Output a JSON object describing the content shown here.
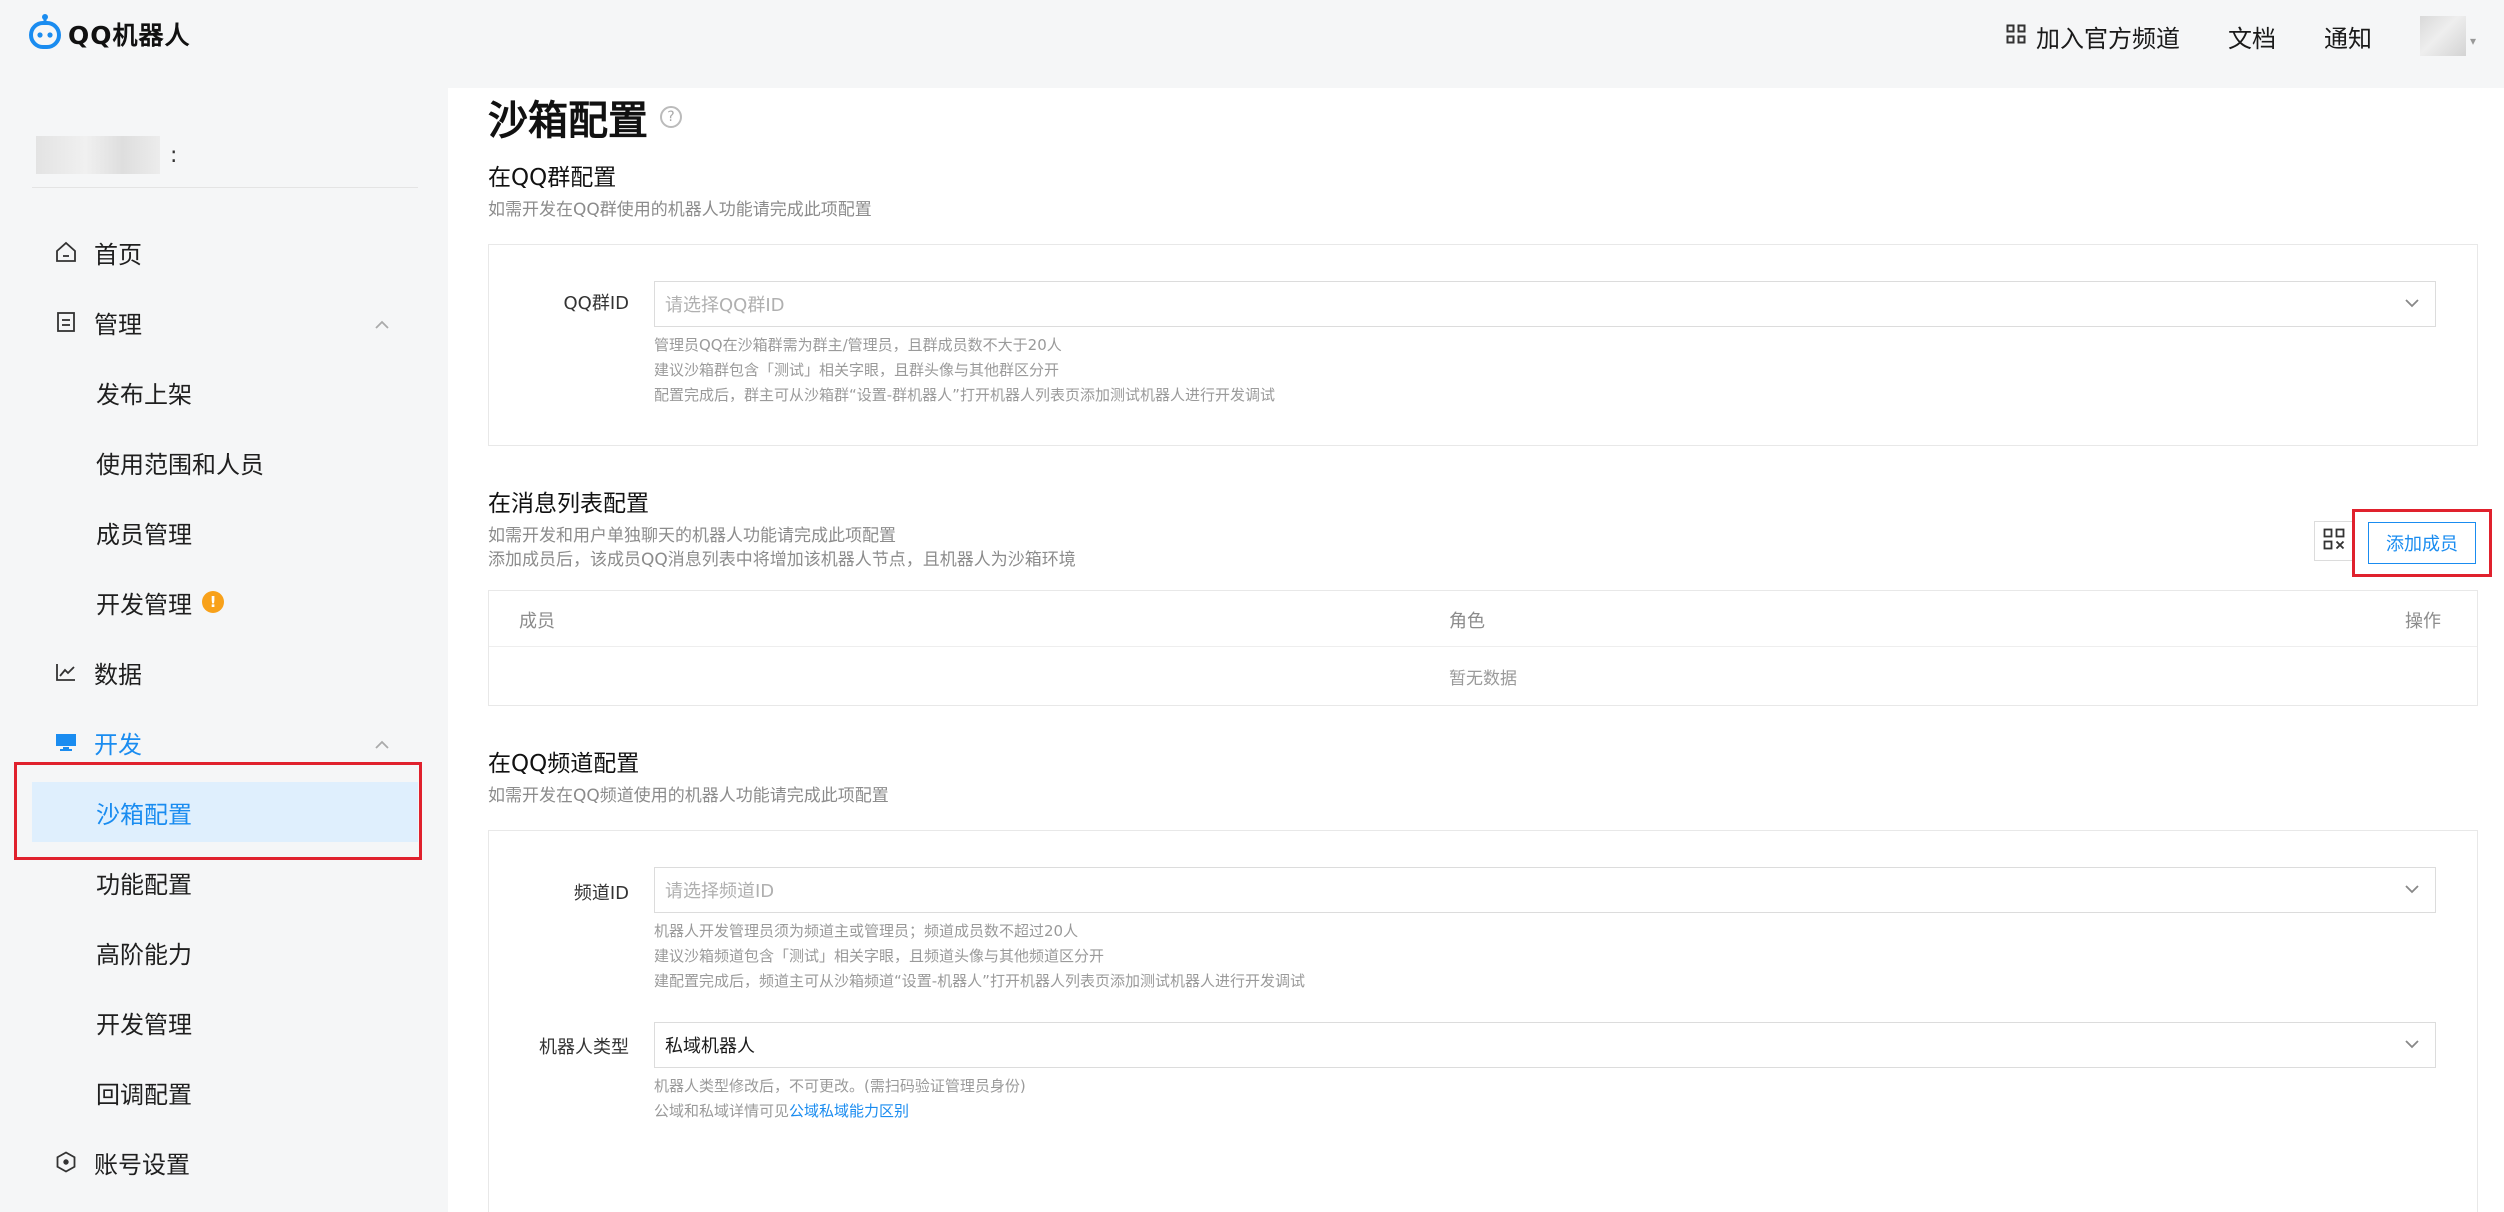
{
  "app": {
    "logo_text": "QQ机器人"
  },
  "topnav": {
    "join_channel": "加入官方频道",
    "docs": "文档",
    "notify": "通知"
  },
  "sidebar": {
    "app_name_suffix": ":",
    "items": [
      {
        "label": "首页"
      },
      {
        "label": "管理"
      },
      {
        "label": "发布上架"
      },
      {
        "label": "使用范围和人员"
      },
      {
        "label": "成员管理"
      },
      {
        "label": "开发管理",
        "badge": "!"
      },
      {
        "label": "数据"
      },
      {
        "label": "开发"
      },
      {
        "label": "沙箱配置"
      },
      {
        "label": "功能配置"
      },
      {
        "label": "高阶能力"
      },
      {
        "label": "开发管理"
      },
      {
        "label": "回调配置"
      },
      {
        "label": "账号设置"
      }
    ]
  },
  "main": {
    "title": "沙箱配置",
    "help": "?",
    "group": {
      "title": "在QQ群配置",
      "desc": "如需开发在QQ群使用的机器人功能请完成此项配置",
      "field_label": "QQ群ID",
      "placeholder": "请选择QQ群ID",
      "hints": [
        "管理员QQ在沙箱群需为群主/管理员，且群成员数不大于20人",
        "建议沙箱群包含「测试」相关字眼，且群头像与其他群区分开",
        "配置完成后，群主可从沙箱群“设置-群机器人”打开机器人列表页添加测试机器人进行开发调试"
      ]
    },
    "msglist": {
      "title": "在消息列表配置",
      "desc1": "如需开发和用户单独聊天的机器人功能请完成此项配置",
      "desc2": "添加成员后，该成员QQ消息列表中将增加该机器人节点，且机器人为沙箱环境",
      "add_button": "添加成员",
      "columns": [
        "成员",
        "角色",
        "操作"
      ],
      "empty": "暂无数据"
    },
    "channel": {
      "title": "在QQ频道配置",
      "desc": "如需开发在QQ频道使用的机器人功能请完成此项配置",
      "field_label": "频道ID",
      "placeholder": "请选择频道ID",
      "hints": [
        "机器人开发管理员须为频道主或管理员；频道成员数不超过20人",
        "建议沙箱频道包含「测试」相关字眼，且频道头像与其他频道区分开",
        "建配置完成后，频道主可从沙箱频道“设置-机器人”打开机器人列表页添加测试机器人进行开发调试"
      ],
      "type_label": "机器人类型",
      "type_value": "私域机器人",
      "type_hint": "机器人类型修改后，不可更改。(需扫码验证管理员身份)",
      "type_hint2_prefix": "公域和私域详情可见",
      "type_hint2_link": "公域私域能力区别"
    }
  },
  "colors": {
    "accent": "#1a8cf0",
    "warning": "#f8a11a",
    "highlight_border": "#e0212d"
  }
}
